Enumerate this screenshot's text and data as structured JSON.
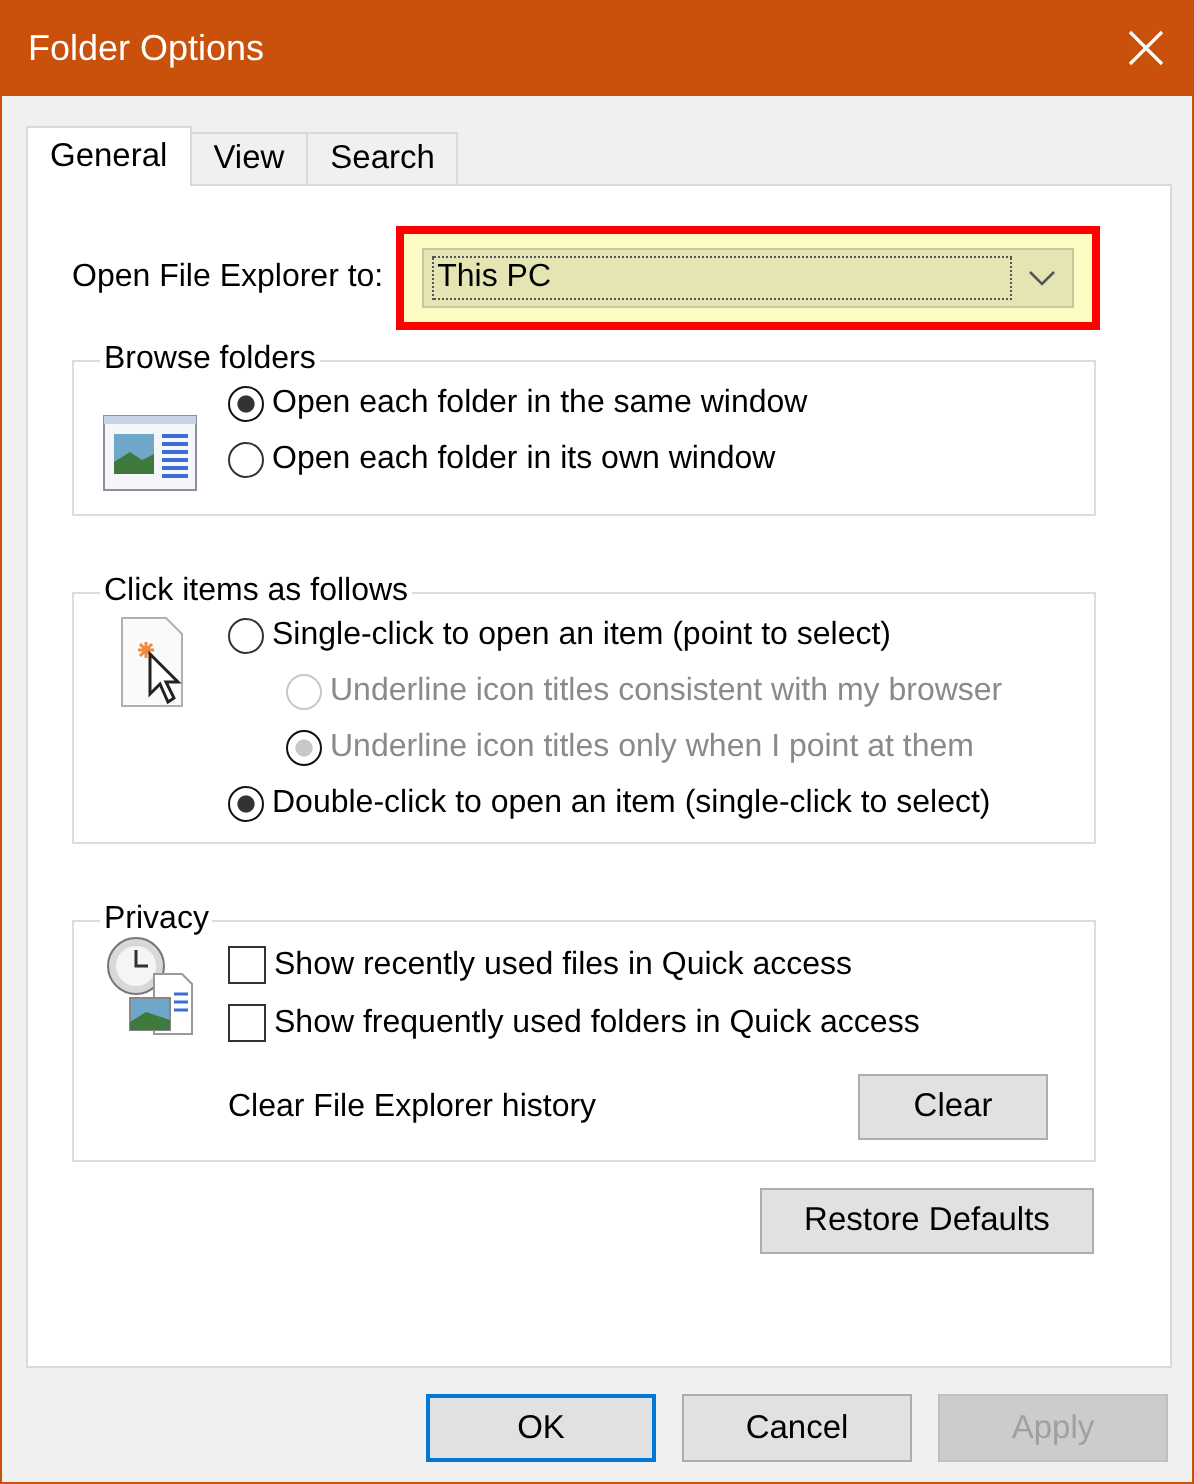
{
  "window": {
    "title": "Folder Options"
  },
  "tabs": [
    {
      "label": "General",
      "selected": true
    },
    {
      "label": "View",
      "selected": false
    },
    {
      "label": "Search",
      "selected": false
    }
  ],
  "open_to": {
    "label": "Open File Explorer to:",
    "value": "This PC",
    "highlighted": true
  },
  "groups": [
    {
      "title": "Browse folders",
      "options": [
        {
          "kind": "radio",
          "label": "Open each folder in the same window",
          "selected": true,
          "disabled": false
        },
        {
          "kind": "radio",
          "label": "Open each folder in its own window",
          "selected": false,
          "disabled": false
        }
      ]
    },
    {
      "title": "Click items as follows",
      "options": [
        {
          "kind": "radio",
          "label": "Single-click to open an item (point to select)",
          "selected": false,
          "disabled": false,
          "children": [
            {
              "kind": "radio",
              "label": "Underline icon titles consistent with my browser",
              "selected": false,
              "disabled": true
            },
            {
              "kind": "radio",
              "label": "Underline icon titles only when I point at them",
              "selected": true,
              "disabled": true
            }
          ]
        },
        {
          "kind": "radio",
          "label": "Double-click to open an item (single-click to select)",
          "selected": true,
          "disabled": false
        }
      ]
    },
    {
      "title": "Privacy",
      "options": [
        {
          "kind": "checkbox",
          "label": "Show recently used files in Quick access",
          "checked": false
        },
        {
          "kind": "checkbox",
          "label": "Show frequently used folders in Quick access",
          "checked": false
        },
        {
          "kind": "action",
          "label": "Clear File Explorer history",
          "button": "Clear"
        }
      ]
    }
  ],
  "restore_button": "Restore Defaults",
  "buttons": [
    {
      "label": "OK",
      "default": true,
      "disabled": false
    },
    {
      "label": "Cancel",
      "default": false,
      "disabled": false
    },
    {
      "label": "Apply",
      "default": false,
      "disabled": true
    }
  ]
}
